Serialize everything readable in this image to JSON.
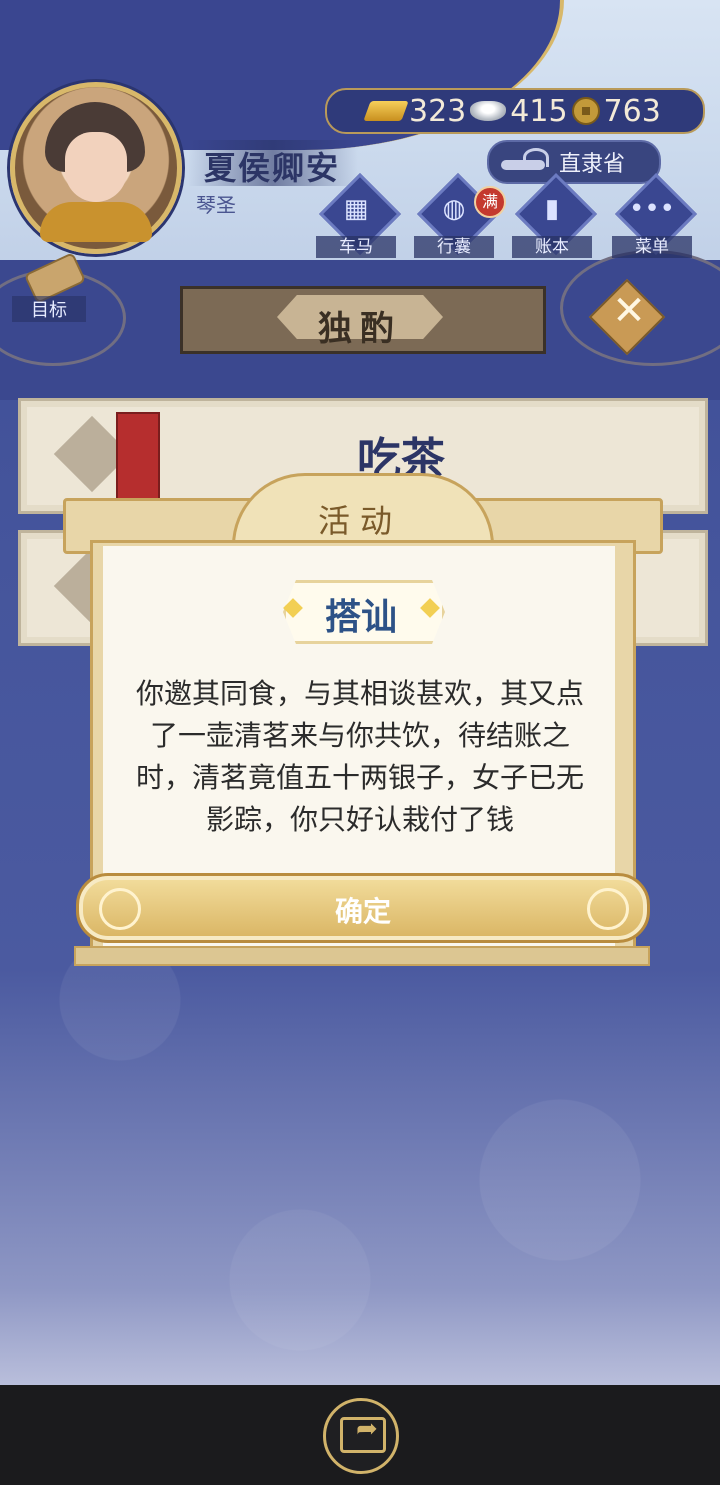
{
  "player": {
    "name": "夏侯卿安",
    "title": "琴圣"
  },
  "resources": [
    {
      "icon": "gold-ingot-icon",
      "value": "323"
    },
    {
      "icon": "silver-ingot-icon",
      "value": "415"
    },
    {
      "icon": "copper-coin-icon",
      "value": "763"
    }
  ],
  "location": "直隶省",
  "menu": [
    {
      "label": "车马",
      "icon": "carriage-icon"
    },
    {
      "label": "行囊",
      "icon": "bag-icon",
      "badge": "满"
    },
    {
      "label": "账本",
      "icon": "ledger-icon"
    },
    {
      "label": "菜单",
      "icon": "more-icon"
    }
  ],
  "goal_label": "目标",
  "scene_title": "独酌",
  "close_glyph": "✕",
  "options": [
    "吃茶"
  ],
  "dialog": {
    "header": "活动",
    "subtitle": "搭讪",
    "story": "你邀其同食，与其相谈甚欢，其又点了一壶清茗来与你共饮，待结账之时，清茗竟值五十两银子，女子已无影踪，你只好认栽付了钱",
    "confirm": "确定"
  }
}
